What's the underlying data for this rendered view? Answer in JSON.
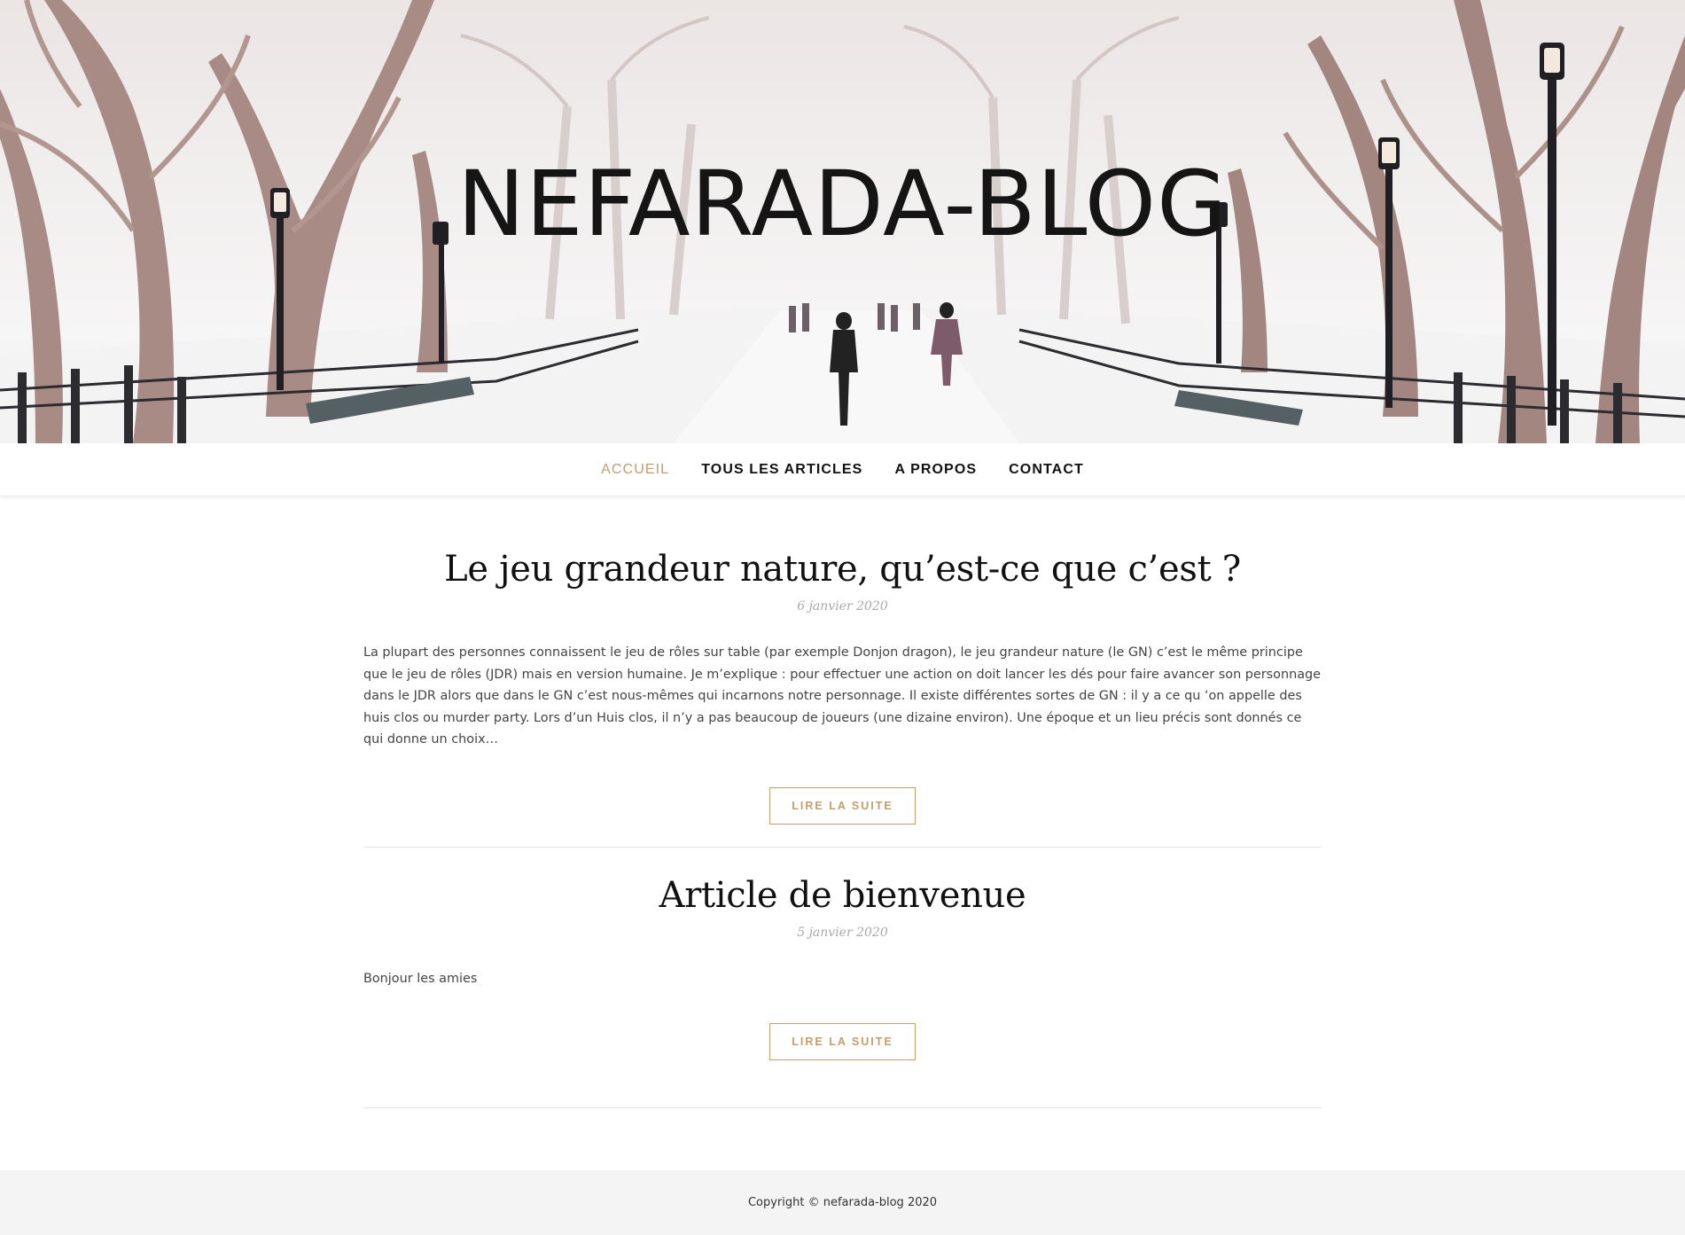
{
  "site": {
    "title": "NEFARADA-BLOG"
  },
  "nav": {
    "items": [
      {
        "label": "ACCUEIL",
        "active": true
      },
      {
        "label": "TOUS LES ARTICLES",
        "active": false
      },
      {
        "label": "A PROPOS",
        "active": false
      },
      {
        "label": "CONTACT",
        "active": false
      }
    ]
  },
  "posts": [
    {
      "title": "Le jeu grandeur nature, qu’est-ce que c’est ?",
      "date": "6 janvier 2020",
      "excerpt": "La plupart des personnes connaissent le jeu de rôles sur table (par exemple Donjon dragon), le jeu grandeur nature (le GN) c’est le même principe que le jeu de rôles (JDR) mais en version humaine. Je m’explique : pour effectuer une action on doit lancer les dés pour faire avancer son personnage dans le JDR alors que dans le GN c’est nous-mêmes qui incarnons notre personnage. Il existe différentes sortes de GN : il y a ce qu ‘on appelle des huis clos ou murder party. Lors d’un Huis clos, il n’y a pas beaucoup de joueurs (une dizaine environ). Une époque et un lieu précis sont donnés ce qui donne un choix…",
      "button": "LIRE LA SUITE"
    },
    {
      "title": "Article de bienvenue",
      "date": "5 janvier 2020",
      "excerpt": "Bonjour les amies",
      "button": "LIRE LA SUITE"
    }
  ],
  "footer": {
    "copyright": "Copyright © nefarada-blog 2020"
  },
  "colors": {
    "accent": "#c69c6d",
    "footer_bg": "#f4f4f4",
    "text": "#444444"
  }
}
